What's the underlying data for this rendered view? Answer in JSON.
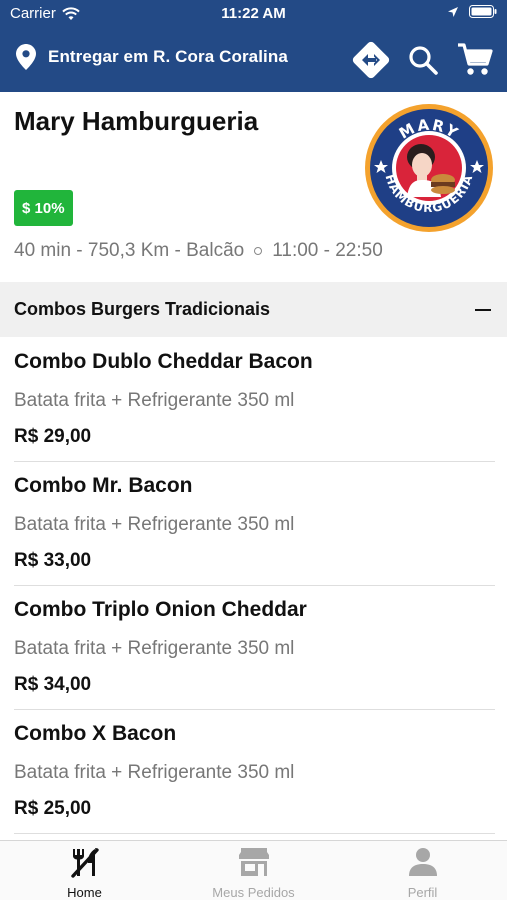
{
  "status_bar": {
    "carrier": "Carrier",
    "time": "11:22 AM"
  },
  "header": {
    "location_text": "Entregar em R. Cora Coralina",
    "icons": [
      "map-pin-icon",
      "directions-icon",
      "search-icon",
      "cart-icon"
    ],
    "color": "#234a86"
  },
  "store": {
    "name": "Mary Hamburgueria",
    "logo_text_top": "MARY",
    "logo_text_bottom": "HAMBURGUERIA",
    "discount": "$ 10%",
    "info": "40 min - 750,3 Km - Balcão",
    "hours": "11:00 - 22:50",
    "discount_color": "#21b53b"
  },
  "category": {
    "title": "Combos Burgers Tradicionais"
  },
  "products": [
    {
      "name": "Combo Dublo Cheddar Bacon",
      "description": "Batata frita + Refrigerante 350 ml",
      "price": "R$ 29,00"
    },
    {
      "name": "Combo Mr. Bacon",
      "description": "Batata frita + Refrigerante 350 ml",
      "price": "R$ 33,00"
    },
    {
      "name": "Combo Triplo Onion Cheddar",
      "description": "Batata frita + Refrigerante 350 ml",
      "price": "R$ 34,00"
    },
    {
      "name": "Combo X Bacon",
      "description": "Batata frita + Refrigerante 350 ml",
      "price": "R$ 25,00"
    }
  ],
  "tabs": [
    {
      "label": "Home",
      "icon": "utensils-icon",
      "active": true
    },
    {
      "label": "Meus Pedidos",
      "icon": "store-icon",
      "active": false
    },
    {
      "label": "Perfil",
      "icon": "user-icon",
      "active": false
    }
  ]
}
